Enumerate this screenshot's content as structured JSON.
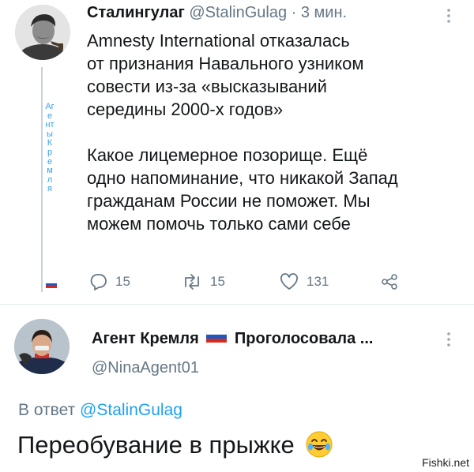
{
  "tweet": {
    "author_name": "Сталингулаг",
    "author_handle": "@StalinGulag",
    "separator": "·",
    "time": "3 мин.",
    "paragraphs": [
      "Amnesty International отказалась\nот признания Навального узником\nсовести из-за «высказываний\nсередины 2000-х годов»",
      "Какое лицемерное позорище. Ещё\nодно напоминание, что никакой Запад\nгражданам России не поможет. Мы\nможем помочь только сами себе"
    ],
    "actions": {
      "replies": "15",
      "retweets": "15",
      "likes": "131"
    }
  },
  "thread_caption": "АгентыКремля",
  "reply": {
    "author_name_part1": "Агент Кремля",
    "author_name_part2": "Проголосовала ...",
    "author_handle": "@NinaAgent01",
    "reply_to_prefix": "В ответ",
    "reply_to_handle": "@StalinGulag",
    "text": "Переобувание в прыжке"
  },
  "watermark": "Fishki.net",
  "colors": {
    "text": "#14171a",
    "secondary": "#657786",
    "link": "#1da1f2",
    "caption": "#3aa0e6"
  },
  "icons": [
    "more-icon",
    "reply-icon",
    "retweet-icon",
    "like-icon",
    "share-icon",
    "russia-flag-icon",
    "laughing-emoji-icon"
  ]
}
